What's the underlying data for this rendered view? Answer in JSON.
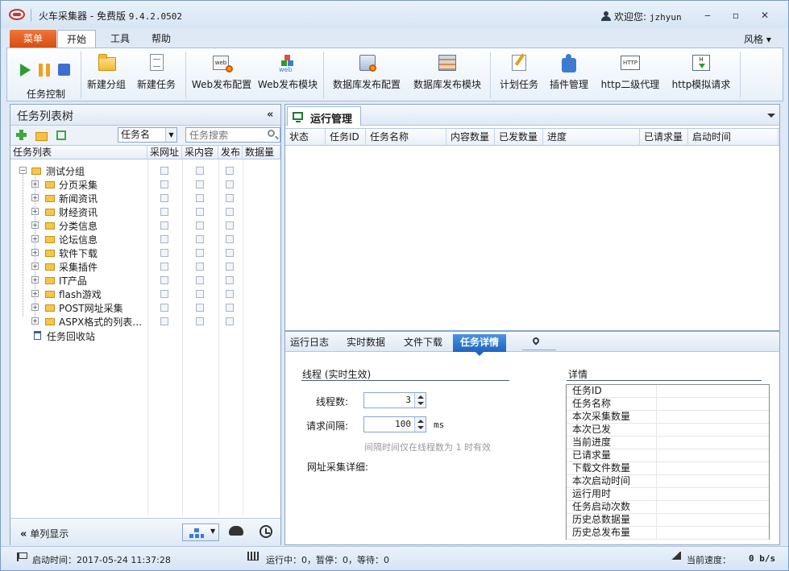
{
  "window": {
    "title": "火车采集器 - 免费版",
    "version": "9.4.2.0502",
    "welcome_label": "欢迎您:",
    "username": "jzhyun",
    "minimize": "‒",
    "restore": "▫",
    "close": "✕"
  },
  "menu": {
    "main": "菜单",
    "tabs": [
      {
        "label": "开始",
        "active": true
      },
      {
        "label": "工具",
        "active": false
      },
      {
        "label": "帮助",
        "active": false
      }
    ],
    "style": "风格 ▾"
  },
  "ribbon": {
    "task_control": "任务控制",
    "items": [
      {
        "label": "新建分组",
        "icon": "folder-icon"
      },
      {
        "label": "新建任务",
        "icon": "new-doc-icon"
      },
      {
        "label": "Web发布配置",
        "icon": "web-config-icon"
      },
      {
        "label": "Web发布模块",
        "icon": "web-module-icon"
      },
      {
        "label": "数据库发布配置",
        "icon": "db-config-icon"
      },
      {
        "label": "数据库发布模块",
        "icon": "db-module-icon"
      },
      {
        "label": "计划任务",
        "icon": "plan-icon"
      },
      {
        "label": "插件管理",
        "icon": "puzzle-icon"
      },
      {
        "label": "http二级代理",
        "icon": "http-proxy-icon"
      },
      {
        "label": "http模拟请求",
        "icon": "http-request-icon"
      }
    ],
    "icon_text_web": "web",
    "icon_text_http": "HTTP",
    "icon_text_h": "H"
  },
  "left_panel": {
    "title": "任务列表树",
    "collapse": "«",
    "search_field_select": "任务名",
    "search_placeholder": "任务搜索",
    "columns": [
      "任务列表",
      "采网址",
      "采内容",
      "发布",
      "数据量"
    ],
    "root": "测试分组",
    "groups": [
      "分页采集",
      "新闻资讯",
      "财经资讯",
      "分类信息",
      "论坛信息",
      "软件下载",
      "采集插件",
      "IT产品",
      "flash游戏",
      "POST网址采集",
      "ASPX格式的列表…"
    ],
    "recycle": "任务回收站",
    "single_column": "单列显示",
    "collapse_foot": "«"
  },
  "run_panel": {
    "tab": "运行管理",
    "columns": [
      "状态",
      "任务ID",
      "任务名称",
      "内容数量",
      "已发数量",
      "进度",
      "已请求量",
      "启动时间"
    ]
  },
  "detail_panel": {
    "tabs": [
      "运行日志",
      "实时数据",
      "文件下载",
      "任务详情"
    ],
    "active_tab": "任务详情",
    "thread_section": "线程 (实时生效)",
    "thread_count_label": "线程数:",
    "thread_count": "3",
    "interval_label": "请求间隔:",
    "interval": "100",
    "interval_unit": "ms",
    "hint": "间隔时间仅在线程数为 1 时有效",
    "url_detail_label": "网址采集详细:",
    "details_section": "详情",
    "details": [
      "任务ID",
      "任务名称",
      "本次采集数量",
      "本次已发",
      "当前进度",
      "已请求量",
      "下载文件数量",
      "本次启动时间",
      "运行用时",
      "任务启动次数",
      "历史总数据量",
      "历史总发布量"
    ]
  },
  "status": {
    "start_time": "启动时间：2017-05-24 11:37:28",
    "running": "运行中：0，暂停：0，等待：0",
    "speed_label": "当前速度：",
    "speed_value": "0 b/s"
  }
}
